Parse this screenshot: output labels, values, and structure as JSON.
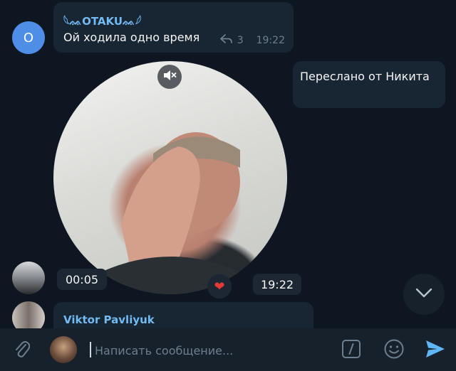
{
  "colors": {
    "background": "#0e1621",
    "bubble": "#182533",
    "accent": "#5eb5f7",
    "sender_name": "#71baf4",
    "meta": "#6d7f8f",
    "heart": "#e53935"
  },
  "messages": [
    {
      "avatar_letter": "O",
      "sender": "𓆩ᨐOTAKUᨐ𓆪",
      "text": "Ой ходила одно время",
      "replies_count": "3",
      "time": "19:22"
    }
  ],
  "forward_notice": "Переслано от Никита",
  "video_message": {
    "mute_icon": "speaker-muted-icon",
    "duration": "00:05",
    "reaction": "❤",
    "time": "19:22"
  },
  "next_message": {
    "sender": "Viktor Pavliyuk"
  },
  "composer": {
    "placeholder": "Написать сообщение...",
    "attach_icon": "paperclip-icon",
    "command_icon": "slash-command-icon",
    "emoji_icon": "emoji-icon",
    "send_icon": "send-icon"
  }
}
